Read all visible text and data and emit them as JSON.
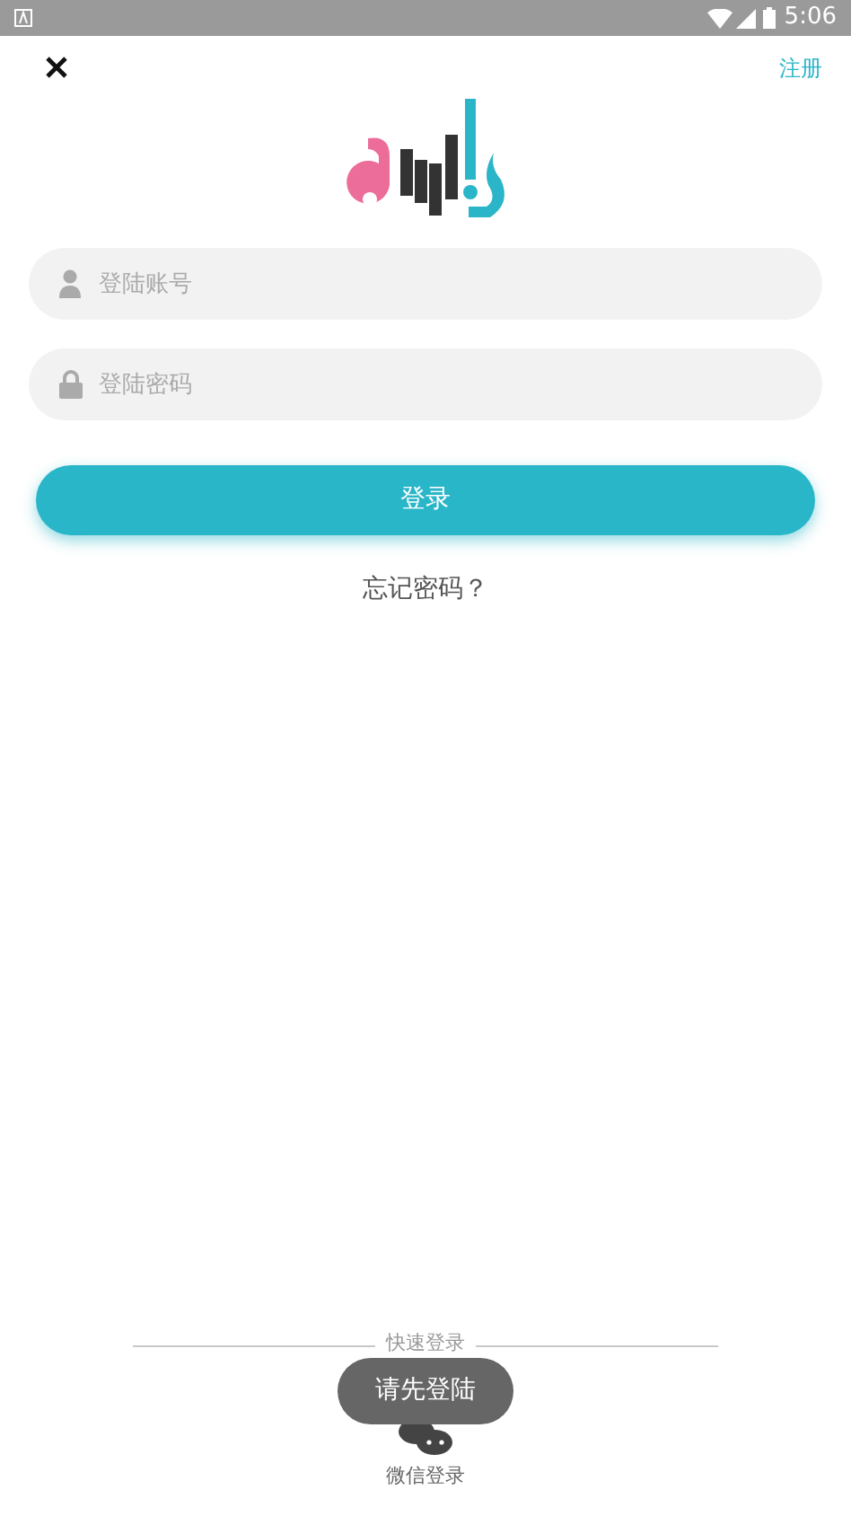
{
  "status_bar": {
    "time": "5:06"
  },
  "header": {
    "register_link": "注册"
  },
  "fields": [
    {
      "kind": "account",
      "placeholder": "登陆账号"
    },
    {
      "kind": "password",
      "placeholder": "登陆密码"
    }
  ],
  "login_button": "登录",
  "forgot_password": "忘记密码？",
  "quick_login": {
    "title": "快速登录",
    "options": [
      {
        "kind": "wechat",
        "label": "微信登录"
      }
    ]
  },
  "toast": "请先登陆"
}
